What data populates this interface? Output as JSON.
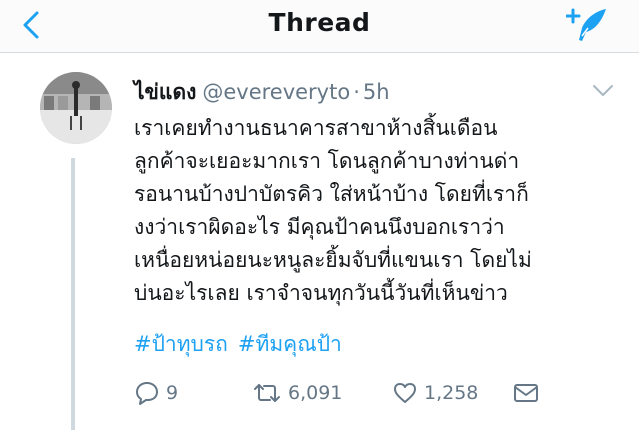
{
  "header": {
    "title": "Thread"
  },
  "tweet": {
    "display_name": "ไข่แดง",
    "handle": "@evereveryto",
    "separator": "·",
    "time": "5h",
    "lines": [
      "เราเคยทำงานธนาคารสาขาห้างสิ้นเดือน",
      "ลูกค้าจะเยอะมากเรา โดนลูกค้าบางท่านด่า",
      "รอนานบ้างปาบัตรคิว ใส่หน้าบ้าง โดยที่เราก็",
      "งงว่าเราผิดอะไร มีคุณป้าคนนึงบอกเราว่า",
      "เหนื่อยหน่อยนะหนูละยิ้มจับที่แขนเรา โดยไม่",
      "บ่นอะไรเลย เราจำจนทุกวันนี้วันที่เห็นข่าว"
    ],
    "hashtags": [
      "#ป้าทุบรถ",
      "#ทีมคุณป้า"
    ]
  },
  "actions": {
    "replies": "9",
    "retweets": "6,091",
    "likes": "1,258"
  },
  "colors": {
    "accent": "#1da1f2",
    "muted": "#657786",
    "text": "#14171a"
  }
}
